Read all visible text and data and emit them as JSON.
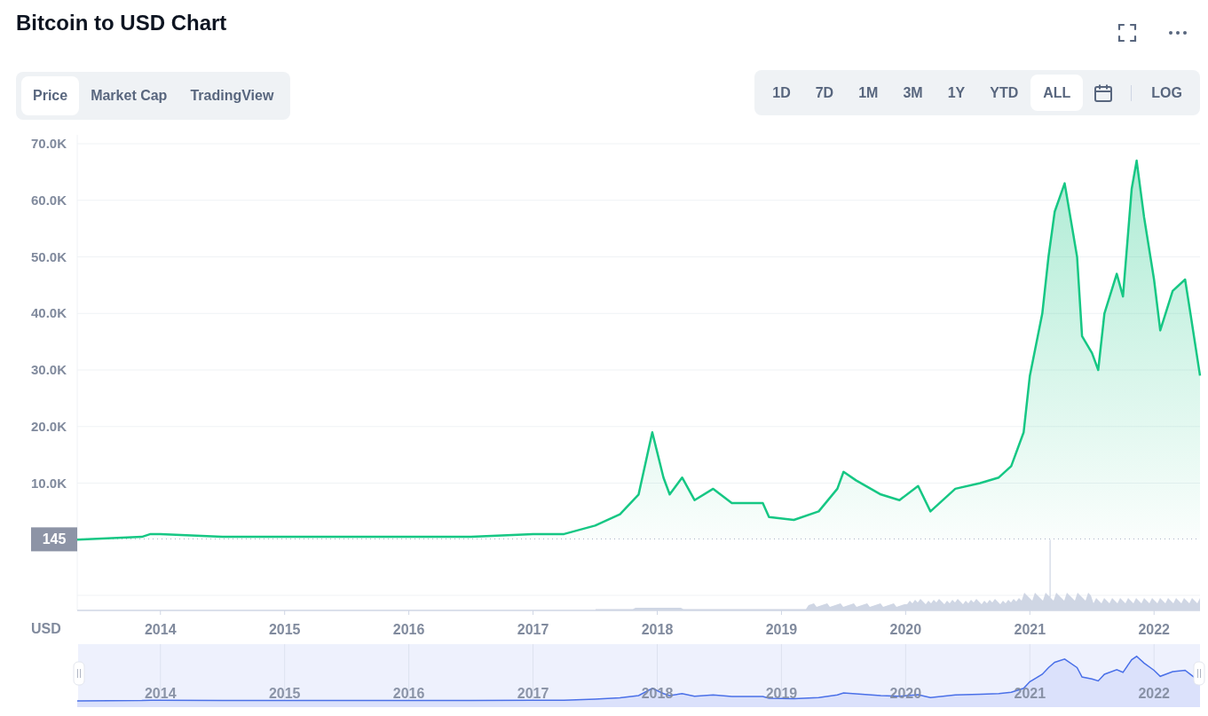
{
  "title": "Bitcoin to USD Chart",
  "view_tabs": [
    {
      "label": "Price",
      "selected": true
    },
    {
      "label": "Market Cap",
      "selected": false
    },
    {
      "label": "TradingView",
      "selected": false
    }
  ],
  "range_buttons": [
    {
      "label": "1D",
      "selected": false
    },
    {
      "label": "7D",
      "selected": false
    },
    {
      "label": "1M",
      "selected": false
    },
    {
      "label": "3M",
      "selected": false
    },
    {
      "label": "1Y",
      "selected": false
    },
    {
      "label": "YTD",
      "selected": false
    },
    {
      "label": "ALL",
      "selected": true
    }
  ],
  "log_toggle": {
    "label": "LOG",
    "on": false
  },
  "chart": {
    "chart_data": {
      "type": "line",
      "ylabel": "USD",
      "x": [
        2013.33,
        2013.85,
        2013.92,
        2014.0,
        2014.5,
        2015.0,
        2015.5,
        2016.0,
        2016.5,
        2017.0,
        2017.25,
        2017.5,
        2017.7,
        2017.85,
        2017.96,
        2018.05,
        2018.1,
        2018.2,
        2018.3,
        2018.45,
        2018.6,
        2018.85,
        2018.9,
        2019.1,
        2019.3,
        2019.45,
        2019.5,
        2019.6,
        2019.8,
        2019.95,
        2020.1,
        2020.2,
        2020.4,
        2020.6,
        2020.75,
        2020.85,
        2020.95,
        2021.0,
        2021.1,
        2021.15,
        2021.2,
        2021.28,
        2021.38,
        2021.42,
        2021.5,
        2021.55,
        2021.6,
        2021.7,
        2021.75,
        2021.82,
        2021.86,
        2021.92,
        2022.0,
        2022.05,
        2022.15,
        2022.25,
        2022.3,
        2022.37
      ],
      "series": [
        {
          "color": "#16c784",
          "values": [
            0,
            500,
            1000,
            1000,
            500,
            500,
            500,
            500,
            500,
            1000,
            1000,
            2500,
            4500,
            8000,
            19000,
            11000,
            8000,
            11000,
            7000,
            9000,
            6500,
            6500,
            4000,
            3500,
            5000,
            9000,
            12000,
            10500,
            8000,
            7000,
            9500,
            5000,
            9000,
            10000,
            11000,
            13000,
            19000,
            29000,
            40000,
            50000,
            58000,
            63000,
            50000,
            36000,
            33000,
            30000,
            40000,
            47000,
            43000,
            62000,
            67000,
            57000,
            46000,
            37000,
            44000,
            46000,
            39000,
            29000
          ]
        }
      ],
      "xticks": [
        {
          "value": 2014,
          "label": "2014"
        },
        {
          "value": 2015,
          "label": "2015"
        },
        {
          "value": 2016,
          "label": "2016"
        },
        {
          "value": 2017,
          "label": "2017"
        },
        {
          "value": 2018,
          "label": "2018"
        },
        {
          "value": 2019,
          "label": "2019"
        },
        {
          "value": 2020,
          "label": "2020"
        },
        {
          "value": 2021,
          "label": "2021"
        },
        {
          "value": 2022,
          "label": "2022"
        }
      ],
      "yticks": [
        {
          "value": 10000,
          "label": "10.0K"
        },
        {
          "value": 20000,
          "label": "20.0K"
        },
        {
          "value": 30000,
          "label": "30.0K"
        },
        {
          "value": 40000,
          "label": "40.0K"
        },
        {
          "value": 50000,
          "label": "50.0K"
        },
        {
          "value": 60000,
          "label": "60.0K"
        },
        {
          "value": 70000,
          "label": "70.0K"
        }
      ],
      "xlim": [
        2013.33,
        2022.37
      ],
      "ylim": [
        -12500,
        70000
      ],
      "grid": true,
      "ref_lines": [
        {
          "axis": "y",
          "value": 145
        }
      ],
      "annotations": [
        {
          "x": 2013.33,
          "y": 145,
          "text": "145"
        }
      ]
    }
  },
  "navigator": {
    "year_labels": [
      "2014",
      "2015",
      "2016",
      "2017",
      "2018",
      "2019",
      "2020",
      "2021",
      "2022"
    ]
  }
}
